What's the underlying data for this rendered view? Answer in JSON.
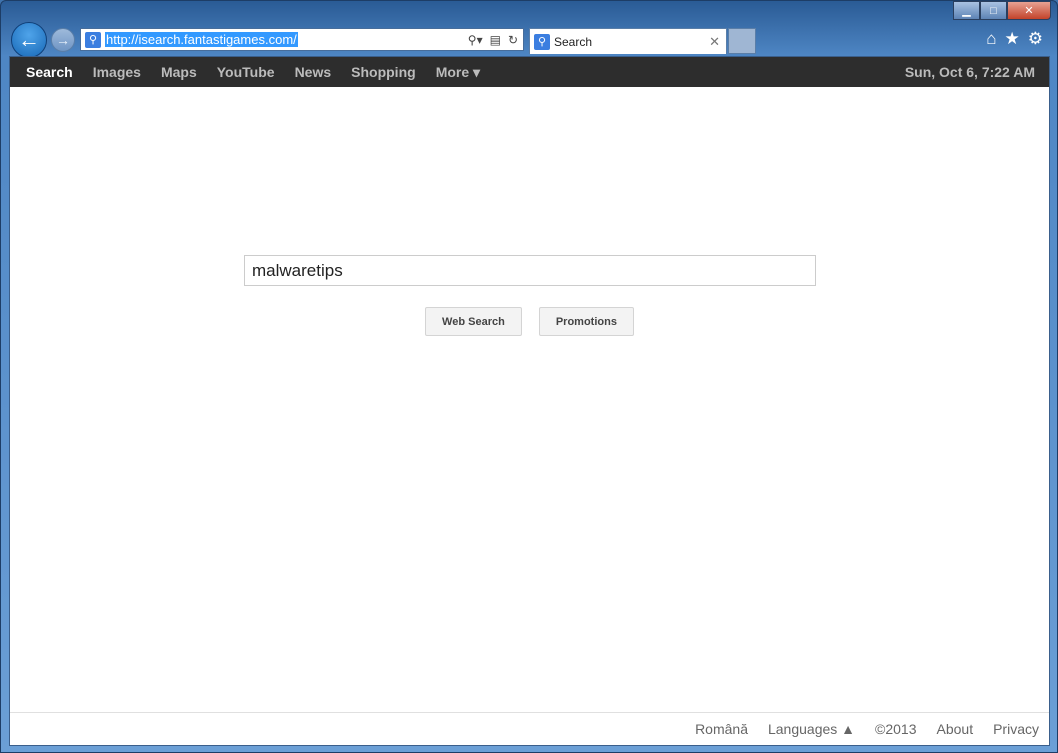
{
  "browser": {
    "url": "http://isearch.fantastigames.com/",
    "tab_title": "Search"
  },
  "nav": {
    "items": [
      "Search",
      "Images",
      "Maps",
      "YouTube",
      "News",
      "Shopping",
      "More ▾"
    ],
    "date": "Sun, Oct 6, 7:22 AM"
  },
  "search": {
    "value": "malwaretips"
  },
  "buttons": {
    "web_search": "Web Search",
    "promotions": "Promotions"
  },
  "footer": {
    "language": "Română",
    "languages": "Languages ▲",
    "copyright": "©2013",
    "about": "About",
    "privacy": "Privacy"
  }
}
